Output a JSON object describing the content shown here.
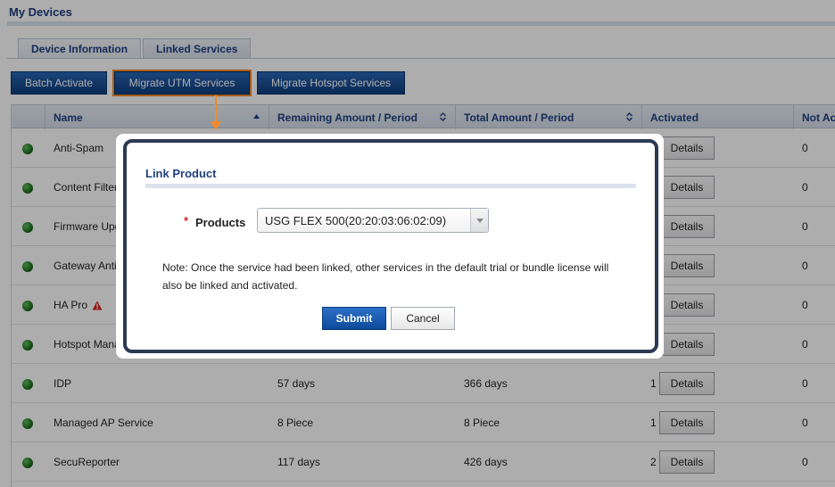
{
  "page": {
    "title": "My Devices"
  },
  "tabs": [
    {
      "label": "Device Information",
      "active": false
    },
    {
      "label": "Linked Services",
      "active": true
    }
  ],
  "toolbar": {
    "batch_activate": "Batch Activate",
    "migrate_utm": "Migrate UTM Services",
    "migrate_hotspot": "Migrate Hotspot Services"
  },
  "table": {
    "headers": {
      "name": "Name",
      "remaining": "Remaining Amount / Period",
      "total": "Total Amount / Period",
      "activated": "Activated",
      "not_activated": "Not Ac"
    },
    "details_label": "Details",
    "rows": [
      {
        "name": "Anti-Spam",
        "remaining": "",
        "total": "",
        "activated": "",
        "not_activated": "0"
      },
      {
        "name": "Content Filter",
        "remaining": "",
        "total": "",
        "activated": "",
        "not_activated": "0"
      },
      {
        "name": "Firmware Upg",
        "remaining": "",
        "total": "",
        "activated": "",
        "not_activated": "0"
      },
      {
        "name": "Gateway Anti",
        "remaining": "",
        "total": "",
        "activated": "",
        "not_activated": "0"
      },
      {
        "name": "HA Pro",
        "remaining": "",
        "total": "",
        "activated": "",
        "not_activated": "0",
        "warning": true
      },
      {
        "name": "Hotspot Mana",
        "remaining": "",
        "total": "",
        "activated": "",
        "not_activated": "0"
      },
      {
        "name": "IDP",
        "remaining": "57 days",
        "total": "366 days",
        "activated": "1",
        "not_activated": "0"
      },
      {
        "name": "Managed AP Service",
        "remaining": "8 Piece",
        "total": "8 Piece",
        "activated": "1",
        "not_activated": "0"
      },
      {
        "name": "SecuReporter",
        "remaining": "117 days",
        "total": "426 days",
        "activated": "2",
        "not_activated": "0"
      }
    ]
  },
  "modal": {
    "title": "Link Product",
    "required_mark": "*",
    "products_label": "Products",
    "products_value": "USG FLEX 500(20:20:03:06:02:09)",
    "note": "Note: Once the service had been linked, other services in the default trial or bundle license will also be linked and activated.",
    "submit": "Submit",
    "cancel": "Cancel"
  },
  "colors": {
    "brand_blue": "#1f3f7f",
    "button_blue": "#0f3e7e",
    "highlight_orange": "#f28a25",
    "status_green": "#146014"
  }
}
